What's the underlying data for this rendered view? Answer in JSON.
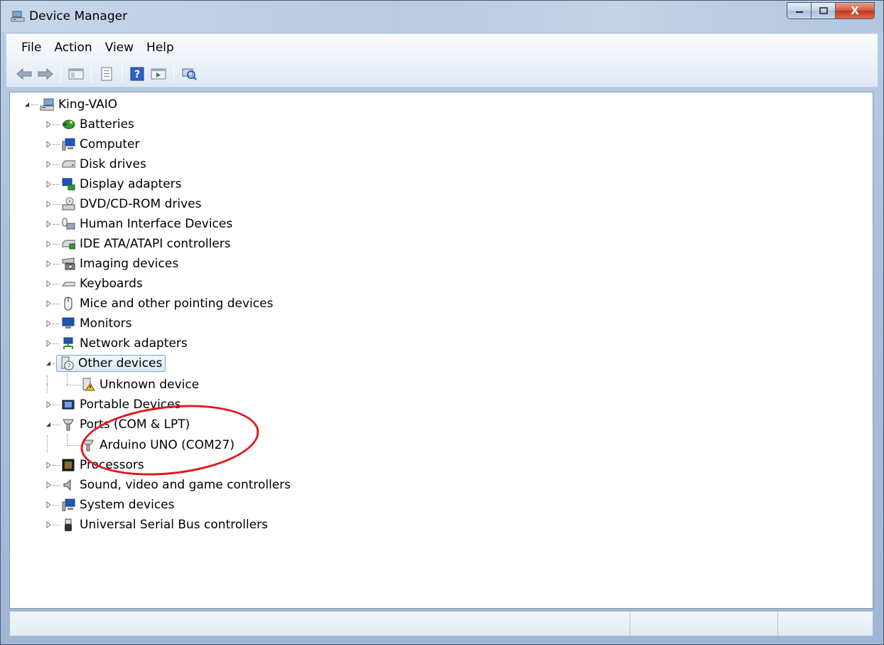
{
  "window": {
    "title": "Device Manager",
    "controls": {
      "minimize": "–",
      "maximize": "□",
      "close": "X"
    },
    "close_color": "#c8401f"
  },
  "menu": [
    "File",
    "Action",
    "View",
    "Help"
  ],
  "toolbar": {
    "buttons": [
      "back-icon",
      "forward-icon",
      "show-hide-tree-icon",
      "properties-icon",
      "help-icon",
      "run-icon",
      "scan-hardware-icon"
    ]
  },
  "tree": {
    "root": "King-VAIO",
    "categories": [
      {
        "label": "Batteries",
        "icon": "battery-icon",
        "expanded": false
      },
      {
        "label": "Computer",
        "icon": "computer-icon",
        "expanded": false
      },
      {
        "label": "Disk drives",
        "icon": "disk-drive-icon",
        "expanded": false
      },
      {
        "label": "Display adapters",
        "icon": "display-adapter-icon",
        "expanded": false
      },
      {
        "label": "DVD/CD-ROM drives",
        "icon": "dvd-drive-icon",
        "expanded": false
      },
      {
        "label": "Human Interface Devices",
        "icon": "hid-icon",
        "expanded": false
      },
      {
        "label": "IDE ATA/ATAPI controllers",
        "icon": "ide-controller-icon",
        "expanded": false
      },
      {
        "label": "Imaging devices",
        "icon": "camera-icon",
        "expanded": false
      },
      {
        "label": "Keyboards",
        "icon": "keyboard-icon",
        "expanded": false
      },
      {
        "label": "Mice and other pointing devices",
        "icon": "mouse-icon",
        "expanded": false
      },
      {
        "label": "Monitors",
        "icon": "monitor-icon",
        "expanded": false
      },
      {
        "label": "Network adapters",
        "icon": "network-icon",
        "expanded": false
      },
      {
        "label": "Other devices",
        "icon": "unknown-device-icon",
        "expanded": true,
        "selected": true,
        "children": [
          {
            "label": "Unknown device",
            "icon": "warning-device-icon"
          }
        ]
      },
      {
        "label": "Portable Devices",
        "icon": "portable-device-icon",
        "expanded": false
      },
      {
        "label": "Ports (COM & LPT)",
        "icon": "port-icon",
        "expanded": true,
        "children": [
          {
            "label": "Arduino UNO (COM27)",
            "icon": "port-icon"
          }
        ]
      },
      {
        "label": "Processors",
        "icon": "processor-icon",
        "expanded": false
      },
      {
        "label": "Sound, video and game controllers",
        "icon": "speaker-icon",
        "expanded": false
      },
      {
        "label": "System devices",
        "icon": "system-icon",
        "expanded": false
      },
      {
        "label": "Universal Serial Bus controllers",
        "icon": "usb-icon",
        "expanded": false
      }
    ]
  },
  "annotation_color": "#e0191f"
}
